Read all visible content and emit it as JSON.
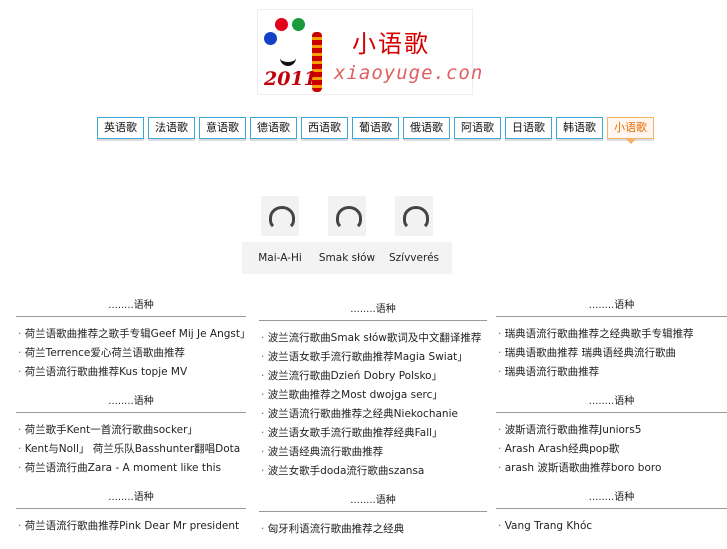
{
  "logo": {
    "cn_text": "小语歌",
    "year": "2011",
    "site_text": "xiaoyuge.con"
  },
  "nav": [
    "英语歌",
    "法语歌",
    "意语歌",
    "德语歌",
    "西语歌",
    "葡语歌",
    "俄语歌",
    "阿语歌",
    "日语歌",
    "韩语歌",
    "小语歌"
  ],
  "featured": [
    "Mai-A-Hi",
    "Smak słów",
    "Szívverés"
  ],
  "columns": [
    {
      "sections": [
        {
          "title": "........语种",
          "items": [
            "荷兰语歌曲推荐之歌手专辑Geef Mij Je Angst」",
            "荷兰Terrence爱心荷兰语歌曲推荐",
            "荷兰语流行歌曲推荐Kus topje MV"
          ]
        },
        {
          "title": "........语种",
          "items": [
            "荷兰歌手Kent一首流行歌曲socker」",
            "Kent与Noll」 荷兰乐队Basshunter翻唱Dota",
            "荷兰语流行曲Zara - A moment like this"
          ]
        },
        {
          "title": "........语种",
          "items": [
            "荷兰语流行歌曲推荐Pink Dear Mr president"
          ]
        }
      ]
    },
    {
      "sections": [
        {
          "title": "........语种",
          "items": [
            "波兰流行歌曲Smak słów歌词及中文翻译推荐",
            "波兰语女歌手流行歌曲推荐Magia Swiat」",
            "波兰流行歌曲Dzień Dobry Polsko」",
            "波兰歌曲推荐之Most dwojga serc」",
            "波兰语流行歌曲推荐之经典Niekochanie",
            "波兰语女歌手流行歌曲推荐经典Fall」",
            "波兰语经典流行歌曲推荐",
            "波兰女歌手doda流行歌曲szansa"
          ]
        },
        {
          "title": "........语种",
          "items": [
            "匈牙利语流行歌曲推荐之经典"
          ]
        }
      ]
    },
    {
      "sections": [
        {
          "title": "........语种",
          "items": [
            "瑞典语流行歌曲推荐之经典歌手专辑推荐",
            "瑞典语歌曲推荐 瑞典语经典流行歌曲",
            "瑞典语流行歌曲推荐"
          ]
        },
        {
          "title": "........语种",
          "items": [
            "波斯语流行歌曲推荐Juniors5",
            "Arash Arash经典pop歌",
            "arash 波斯语歌曲推荐boro boro"
          ]
        },
        {
          "title": "........语种",
          "items": [
            "Vang Trang Khóc"
          ]
        }
      ]
    }
  ]
}
